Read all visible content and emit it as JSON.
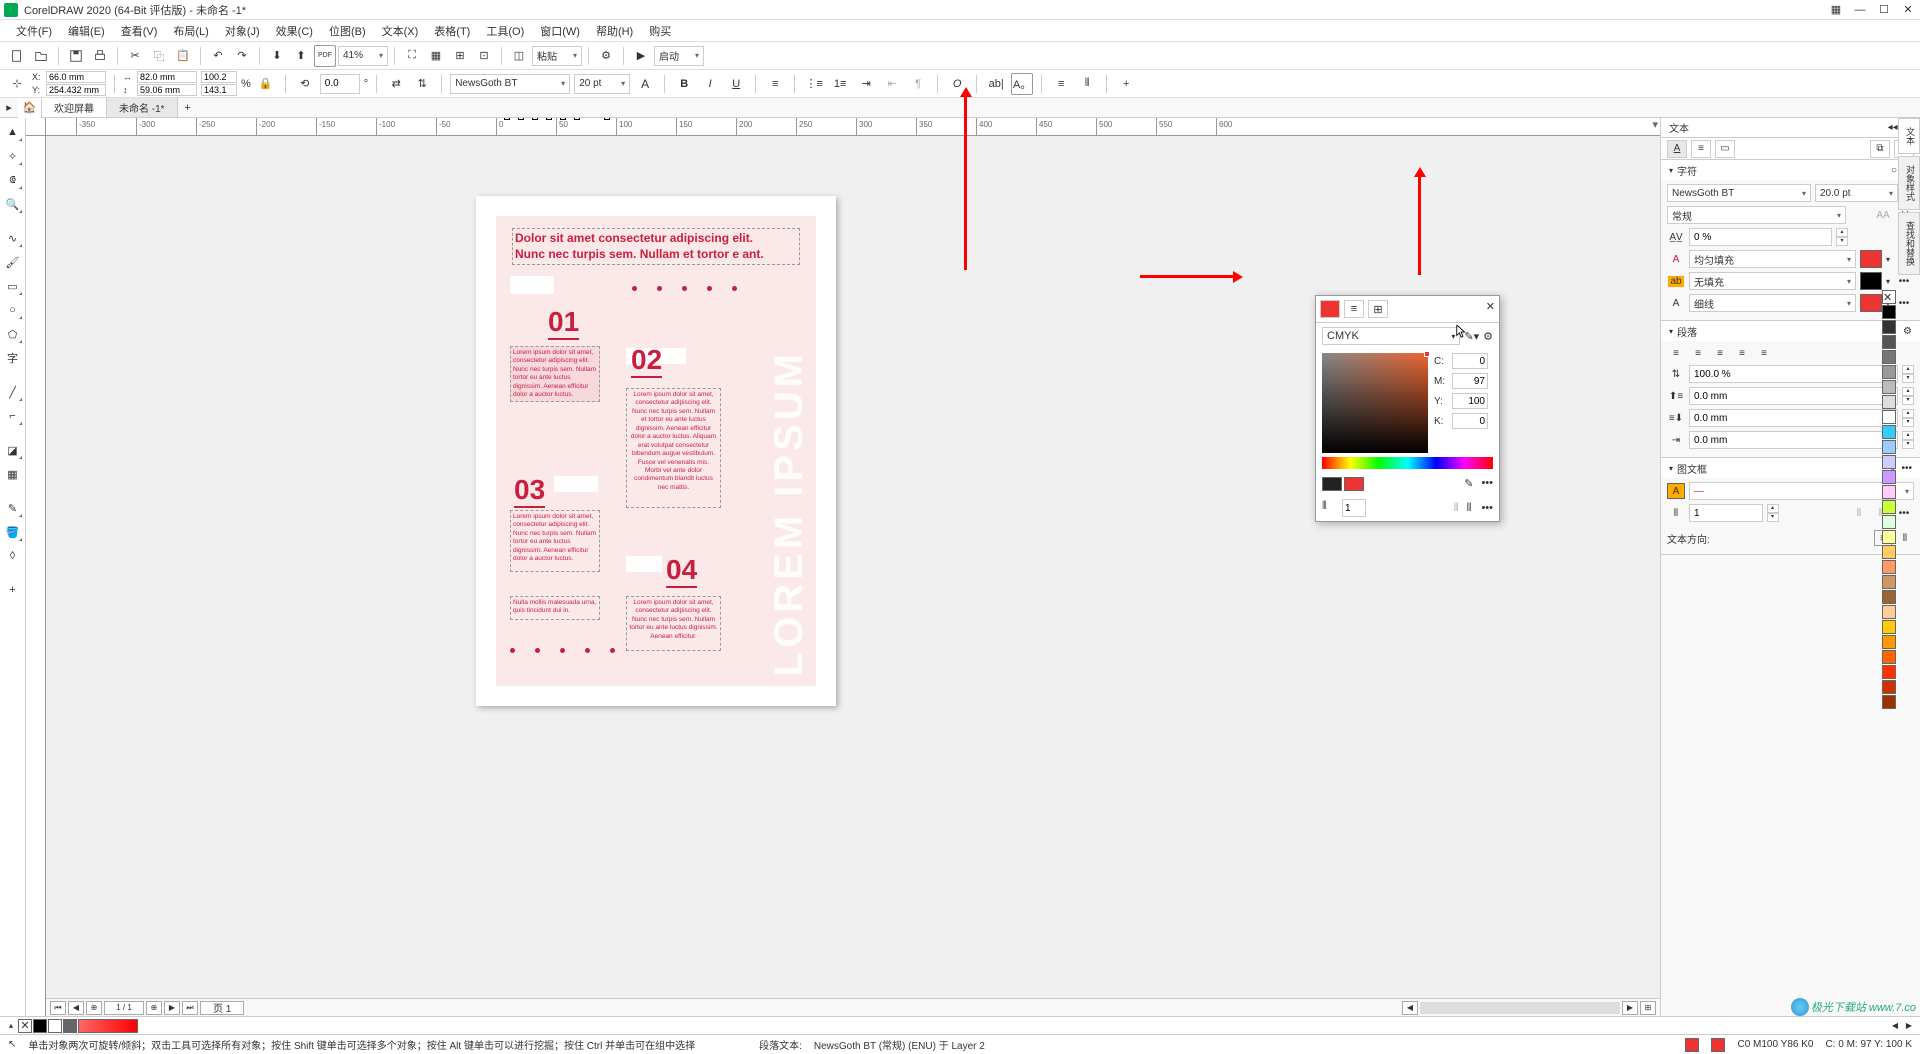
{
  "app": {
    "title": "CorelDRAW 2020 (64-Bit 评估版) - 未命名 -1*"
  },
  "menu": [
    "文件(F)",
    "编辑(E)",
    "查看(V)",
    "布局(L)",
    "对象(J)",
    "效果(C)",
    "位图(B)",
    "文本(X)",
    "表格(T)",
    "工具(O)",
    "窗口(W)",
    "帮助(H)",
    "购买"
  ],
  "toolbar": {
    "zoom": "41%",
    "paste": "粘贴",
    "launch": "启动"
  },
  "propbar": {
    "x": "66.0 mm",
    "y": "254.432 mm",
    "w": "82.0 mm",
    "h": "59.06 mm",
    "sx": "100.2",
    "sy": "143.1",
    "pct": "%",
    "rot": "0.0",
    "deg": "°",
    "font": "NewsGoth BT",
    "size": "20 pt"
  },
  "tabs": {
    "home": "欢迎屏幕",
    "doc": "未命名 -1*"
  },
  "ruler_ticks": [
    "-350",
    "-300",
    "-250",
    "-200",
    "-150",
    "-100",
    "-50",
    "0",
    "50",
    "100",
    "150",
    "200",
    "250",
    "300",
    "350",
    "400",
    "450",
    "500",
    "550",
    "600"
  ],
  "page": {
    "headline1": "Dolor sit amet consectetur adipiscing elit.",
    "headline2": "Nunc nec turpis sem. Nullam et tortor e ant.",
    "n01": "01",
    "n02": "02",
    "n03": "03",
    "n04": "04",
    "lorem1": "Lorem ipsum dolor sit amet, consectetur adipiscing elit. Nunc nec turpis sem. Nullam tortor eu ante luctus dignissim. Aenean efficitur dolor a auctor luctus.",
    "lorem2": "Lorem ipsum dolor sit amet, consectetur adipiscing elit. Nunc nec turpis sem. Nullam et tortor eu ante luctus dignissim. Aenean efficitur dolor a auctor luctus.\n\nAliquam erat volutpat consectetur bibendum augue vestibulum. Fusce vel venenatis mis. Morbi vel ante dolor condimentum blandit luctus nec mattis.",
    "lorem3": "Lorem ipsum dolor sit amet, consectetur adipiscing elit. Nunc nec turpis sem. Nullam tortor eu ante luctus dignissim. Aenean efficitur dolor a auctor luctus.",
    "lorem4": "Nulla mollis malesuada urna, quis tincidunt dui in.",
    "lorem5": "Lorem ipsum dolor sit amet, consectetur adipiscing elit. Nunc nec turpis sem. Nullam tortor eu ante luctus dignissim. Aenean efficitur.",
    "vertical": "LOREM IPSUM"
  },
  "page_nav": {
    "page1": "页 1"
  },
  "status": {
    "hint": "单击对象两次可旋转/倾斜；双击工具可选择所有对象；按住 Shift 键单击可选择多个对象；按住 Alt 键单击可以进行挖掘；按住 Ctrl 并单击可在组中选择",
    "para_label": "段落文本:",
    "para_value": "NewsGoth BT (常规) (ENU) 于 Layer 2",
    "color_label": "C0 M100 Y86 K0",
    "cmyk_right": "C: 0 M: 97 Y: 100 K"
  },
  "docker": {
    "title": "文本",
    "sec_char": "字符",
    "font": "NewsGoth BT",
    "size": "20.0 pt",
    "weight": "常规",
    "kerning": "0 %",
    "fill": "均匀填充",
    "nofill": "无填充",
    "outline": "细线",
    "sec_para": "段落",
    "line_pct": "100.0 %",
    "sp_before": "0.0 mm",
    "sp_after": "0.0 mm",
    "sp_line": "0.0 mm",
    "sec_frame": "图文框",
    "cols": "1",
    "dir_label": "文本方向:"
  },
  "color_popup": {
    "model": "CMYK",
    "c_lbl": "C:",
    "c": "0",
    "m_lbl": "M:",
    "m": "97",
    "y_lbl": "Y:",
    "y": "100",
    "k_lbl": "K:",
    "k": "0"
  },
  "side_tabs": [
    "文本",
    "对象样式",
    "查找和替换"
  ],
  "watermark": "极光下载站 www.7.co"
}
